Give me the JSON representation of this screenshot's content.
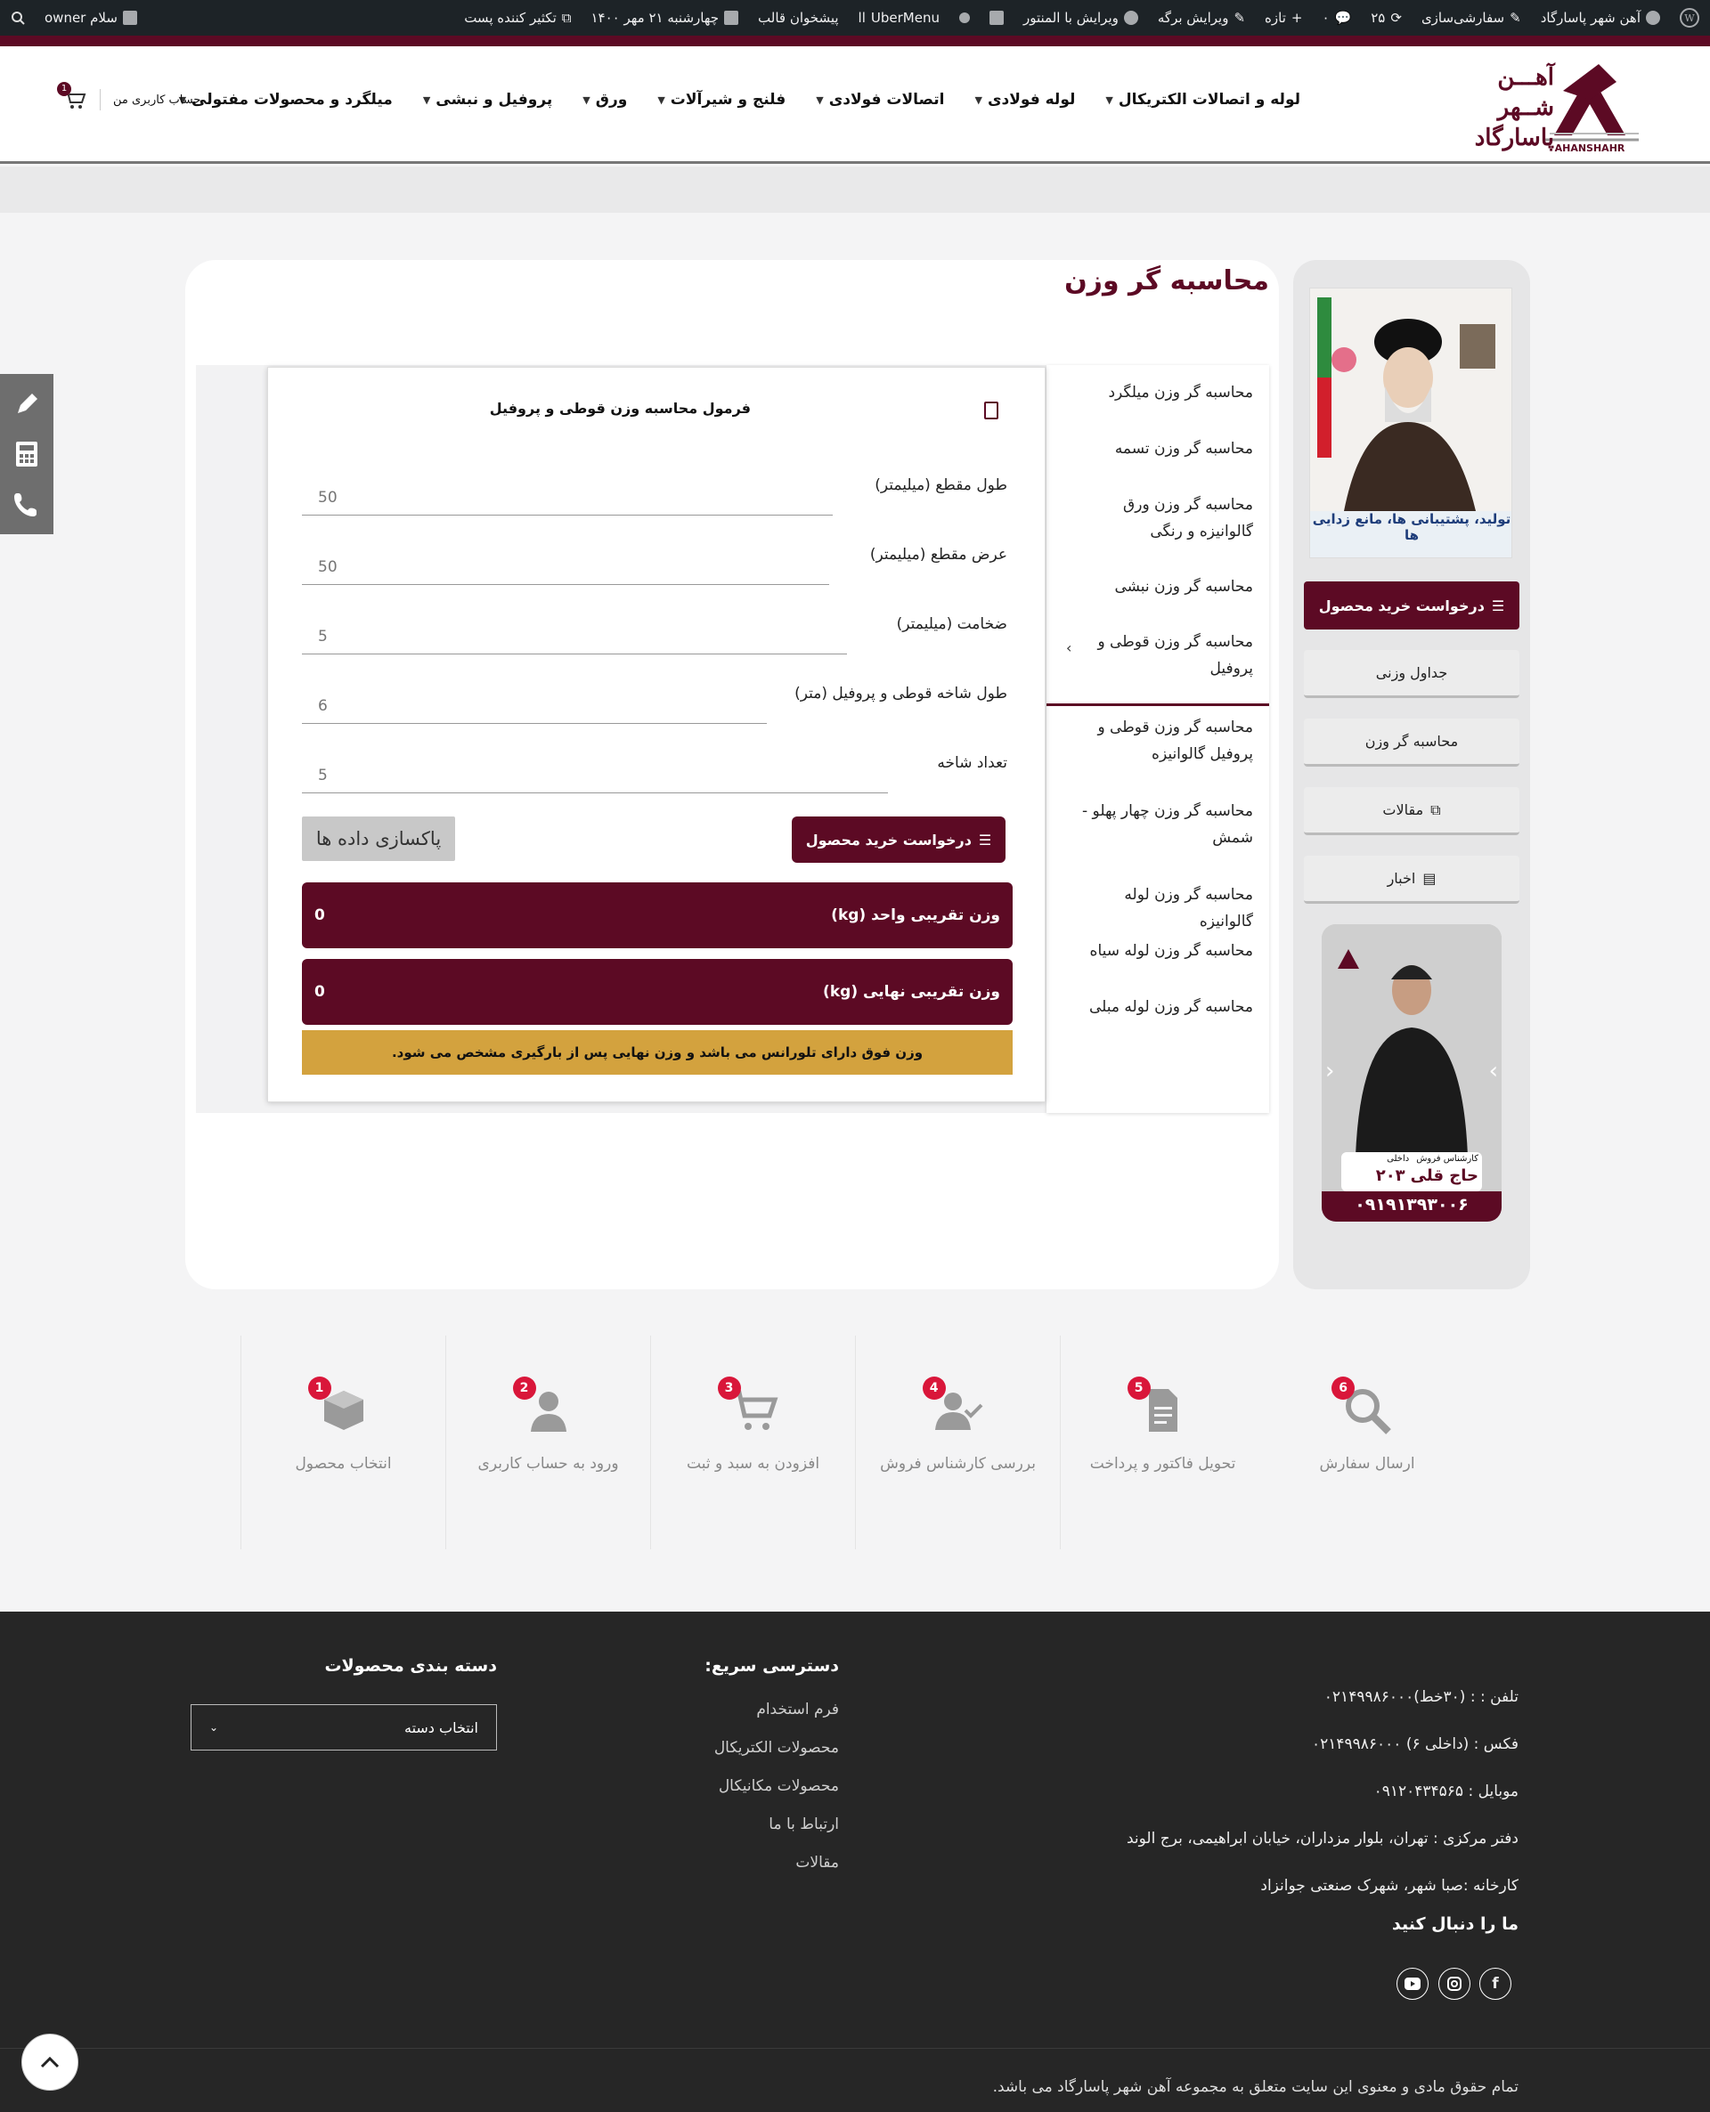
{
  "adminbar": {
    "site_name": "آهن شهر پاسارگاد",
    "customize": "سفارشی‌سازی",
    "updates": "۲۵",
    "new": "تازه",
    "edit_page": "ویرایش برگه",
    "edit_elementor": "ویرایش با المنتور",
    "ubermenu": "UberMenu",
    "theme_preview": "پیشخوان قالب",
    "date": "چهارشنبه ۲۱ مهر ۱۴۰۰",
    "duplicate": "تکثیر کننده پست",
    "greeting": "سلام owner"
  },
  "header": {
    "logo_line1": "آهـــن",
    "logo_line2": "شــهر",
    "logo_line3": "پاسارگاد",
    "logo_brand": "AHANSHAHR",
    "nav": [
      "لوله و اتصالات الکتریکال",
      "لوله فولادی",
      "اتصالات فولادی",
      "فلنج و شیرآلات",
      "ورق",
      "پروفیل و نبشی",
      "میلگرد و محصولات مفتولی"
    ],
    "account_label": "حساب کاربری من",
    "cart_count": "1"
  },
  "page": {
    "title": "محاسبه گر وزن"
  },
  "calc_menu": [
    "محاسبه گر وزن میلگرد",
    "محاسبه گر وزن تسمه",
    "محاسبه گر وزن ورق گالوانیزه و رنگی",
    "محاسبه گر وزن نبشی",
    "محاسبه گر وزن قوطی و پروفیل",
    "محاسبه گر وزن قوطی و پروفیل گالوانیزه",
    "محاسبه گر وزن چهار پهلو - شمش",
    "محاسبه گر وزن لوله گالوانیزه",
    "محاسبه گر وزن لوله سیاه",
    "محاسبه گر وزن لوله مبلی"
  ],
  "calculator": {
    "heading": "فرمول محاسبه وزن قوطی و پروفیل",
    "fields": [
      {
        "label": "طول مقطع (میلیمتر)",
        "value": "50"
      },
      {
        "label": "عرض مقطع (میلیمتر)",
        "value": "50"
      },
      {
        "label": "ضخامت (میلیمتر)",
        "value": "5"
      },
      {
        "label": "طول شاخه قوطی و پروفیل (متر)",
        "value": "6"
      },
      {
        "label": "تعداد شاخه",
        "value": "5"
      }
    ],
    "request_button": "درخواست خرید محصول",
    "clear_button": "پاکسازی داده ها",
    "unit_weight_label": "وزن تقریبی واحد (kg)",
    "unit_weight_value": "0",
    "final_weight_label": "وزن تقریبی نهایی (kg)",
    "final_weight_value": "0",
    "note": "وزن فوق دارای تلورانس می باشد و وزن نهایی پس از بارگیری مشخص می شود."
  },
  "sidebar": {
    "poster_caption": "تولید، پشتیبانی ها، مانع زدایی ها",
    "request_button": "درخواست خرید محصول",
    "links": [
      "جداول وزنی",
      "محاسبه گر وزن",
      "مقالات",
      "اخبار"
    ],
    "sales_role": "کارشناس فروش",
    "sales_internal": "داخلی",
    "sales_name": "حاج قلی",
    "sales_ext": "۲۰۳",
    "sales_phone": "۰۹۱۹۱۳۹۳۰۰۶"
  },
  "steps": [
    {
      "num": "1",
      "label": "انتخاب محصول",
      "icon": "box-icon"
    },
    {
      "num": "2",
      "label": "ورود به حساب کاربری",
      "icon": "user-icon"
    },
    {
      "num": "3",
      "label": "افزودن به سبد و ثبت",
      "icon": "cart-icon"
    },
    {
      "num": "4",
      "label": "بررسی کارشناس فروش",
      "icon": "user-check-icon"
    },
    {
      "num": "5",
      "label": "تحویل فاکتور و پرداخت",
      "icon": "document-icon"
    },
    {
      "num": "6",
      "label": "ارسال سفارش",
      "icon": "search-icon"
    }
  ],
  "footer": {
    "phone": "تلفن : : (۳۰خط)۰۲۱۴۹۹۸۶۰۰۰",
    "fax": "فکس :  (داخلی ۶) ۰۲۱۴۹۹۸۶۰۰۰",
    "mobile": "موبایل : ۰۹۱۲۰۴۳۴۵۶۵",
    "office": "دفتر مرکزی : تهران، بلوار مزداران، خیابان ابراهیمی، برج الوند",
    "factory": "کارخانه :صبا شهر، شهرک صنعتی جوانزاد",
    "follow_title": "ما را دنبال کنید",
    "quick_title": "دسترسی سریع:",
    "quick_links": [
      "فرم استخدام",
      "محصولات الکتریکال",
      "محصولات مکانیکال",
      "ارتباط با ما",
      "مقالات"
    ],
    "category_title": "دسته بندی محصولات",
    "category_select": "انتخاب دسته",
    "copyright": "تمام حقوق مادی و معنوی این سایت متعلق به مجموعه آهن شهر پاسارگاد می باشد."
  },
  "colors": {
    "brand": "#5c0a24",
    "note_bg": "#d3a23e",
    "step_badge": "#d9163a",
    "footer_bg": "#262626"
  }
}
